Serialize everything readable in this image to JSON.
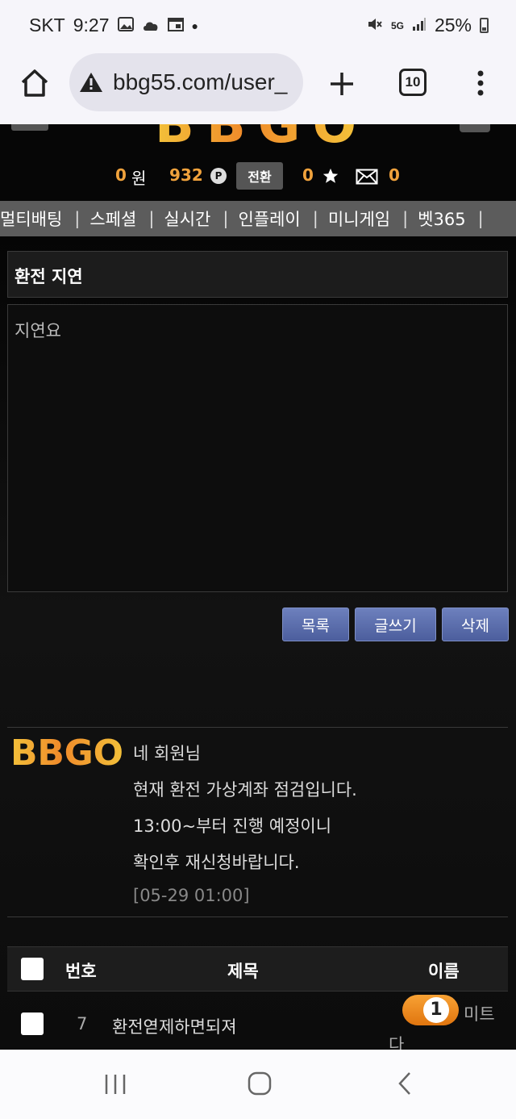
{
  "status_bar": {
    "carrier": "SKT",
    "time": "9:27",
    "network": "5G",
    "battery": "25%"
  },
  "browser": {
    "url": "bbg55.com/user_",
    "tab_count": "10"
  },
  "site": {
    "logo": "BBGO",
    "balance_value": "0",
    "balance_unit": "원",
    "points_value": "932",
    "points_badge": "P",
    "convert_label": "전환",
    "stars_value": "0",
    "messages_value": "0",
    "nav": [
      "멀티배팅",
      "스페셜",
      "실시간",
      "인플레이",
      "미니게임",
      "벳365"
    ]
  },
  "post": {
    "title": "환전 지연",
    "body": "지연요"
  },
  "actions": {
    "list_label": "목록",
    "write_label": "글쓰기",
    "delete_label": "삭제"
  },
  "reply": {
    "lines": [
      "네 회원님",
      "현재 환전 가상계좌 점검입니다.",
      "13:00~부터 진행 예정이니",
      "확인후 재신청바랍니다."
    ],
    "time": "[05-29 01:00]"
  },
  "table": {
    "headers": {
      "number": "번호",
      "title": "제목",
      "name": "이름"
    },
    "rows": [
      {
        "number": "7",
        "title": "환전엳제하면되져",
        "level": "1",
        "name_part1": "미트",
        "name_part2": "다"
      }
    ]
  },
  "colors": {
    "accent_orange": "#f0a23c",
    "button_blue": "#5a6cab",
    "nav_gray": "#5c5c5c"
  }
}
